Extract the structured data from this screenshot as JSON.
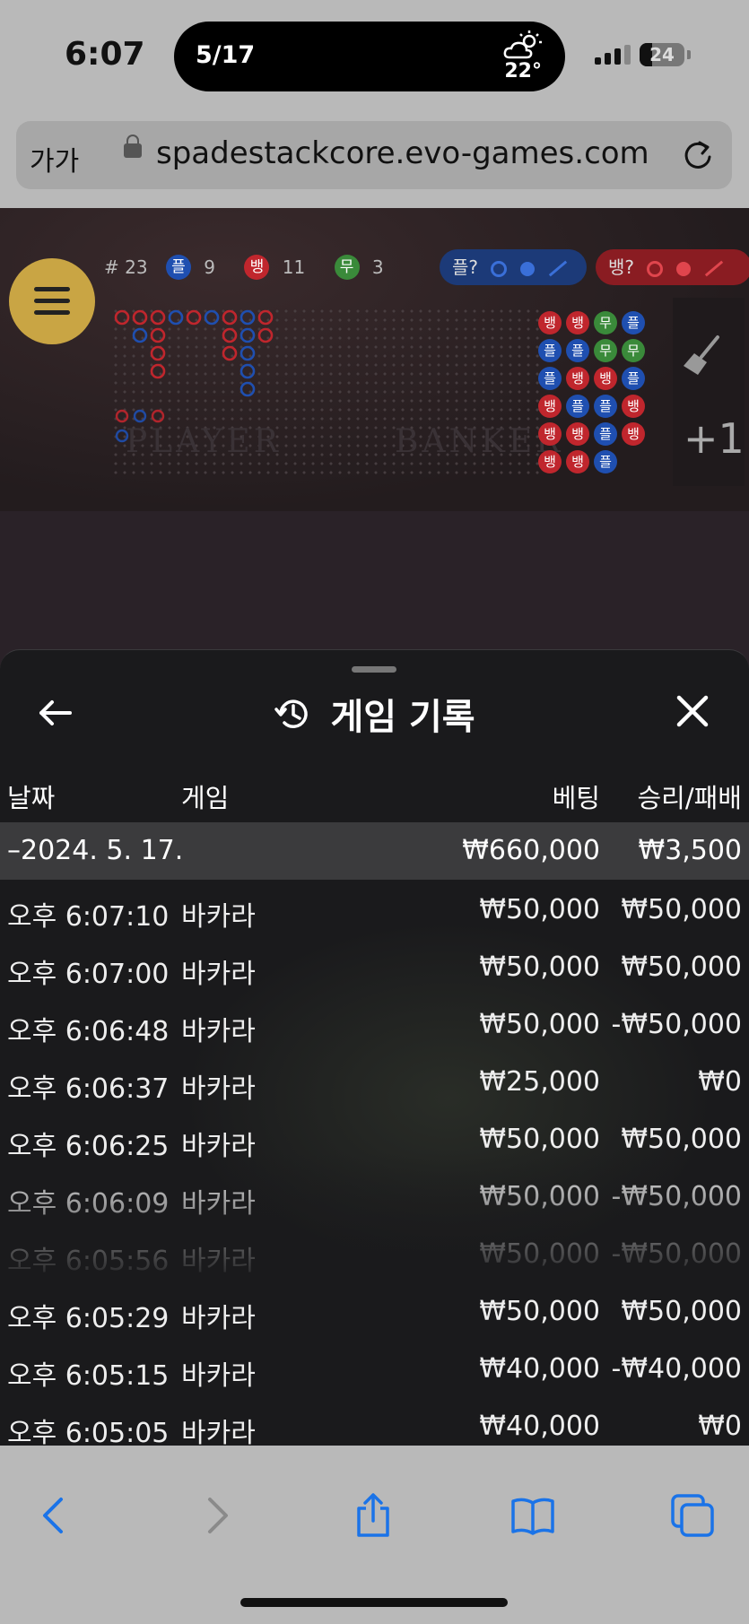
{
  "status_bar": {
    "time": "6:07",
    "island_date": "5/17",
    "island_temp": "22°",
    "weather_icon": "partly-cloudy-icon",
    "battery": "24"
  },
  "browser": {
    "reader_label": "가가",
    "url": "spadestackcore.evo-games.com"
  },
  "game": {
    "round_label": "# 23",
    "player_badge": "플",
    "player_count": "9",
    "banker_badge": "뱅",
    "banker_count": "11",
    "tie_badge": "무",
    "tie_count": "3",
    "player_predict": "플?",
    "banker_predict": "뱅?",
    "watermark_player": "PLAYER",
    "watermark_banker": "BANKER",
    "plus_label": "+1",
    "bead_plate": [
      [
        "뱅",
        "뱅",
        "무",
        "플"
      ],
      [
        "플",
        "플",
        "무",
        "무"
      ],
      [
        "플",
        "뱅",
        "뱅",
        "플"
      ],
      [
        "뱅",
        "플",
        "플",
        "뱅"
      ],
      [
        "뱅",
        "뱅",
        "플",
        "뱅"
      ],
      [
        "뱅",
        "뱅",
        "플",
        ""
      ]
    ],
    "colors": {
      "player": "#1f4fb0",
      "banker": "#c0262d",
      "tie": "#3a8a3a",
      "menu": "#c9a544"
    }
  },
  "history": {
    "title": "게임 기록",
    "columns": {
      "date": "날짜",
      "game": "게임",
      "bet": "베팅",
      "result": "승리/패배"
    },
    "date_group": {
      "date": "–2024. 5. 17.",
      "bet": "₩660,000",
      "result": "₩3,500"
    },
    "rows": [
      {
        "time": "오후 6:07:10",
        "game": "바카라",
        "bet": "₩50,000",
        "result": "₩50,000"
      },
      {
        "time": "오후 6:07:00",
        "game": "바카라",
        "bet": "₩50,000",
        "result": "₩50,000"
      },
      {
        "time": "오후 6:06:48",
        "game": "바카라",
        "bet": "₩50,000",
        "result": "-₩50,000"
      },
      {
        "time": "오후 6:06:37",
        "game": "바카라",
        "bet": "₩25,000",
        "result": "₩0"
      },
      {
        "time": "오후 6:06:25",
        "game": "바카라",
        "bet": "₩50,000",
        "result": "₩50,000"
      },
      {
        "time": "오후 6:06:09",
        "game": "바카라",
        "bet": "₩50,000",
        "result": "-₩50,000"
      },
      {
        "time": "오후 6:05:56",
        "game": "바카라",
        "bet": "₩50,000",
        "result": "-₩50,000"
      },
      {
        "time": "오후 6:05:29",
        "game": "바카라",
        "bet": "₩50,000",
        "result": "₩50,000"
      },
      {
        "time": "오후 6:05:15",
        "game": "바카라",
        "bet": "₩40,000",
        "result": "-₩40,000"
      },
      {
        "time": "오후 6:05:05",
        "game": "바카라",
        "bet": "₩40,000",
        "result": "₩0"
      }
    ]
  },
  "toolbar": {
    "back_icon": "chevron-left-icon",
    "forward_icon": "chevron-right-icon",
    "share_icon": "share-icon",
    "bookmarks_icon": "book-icon",
    "tabs_icon": "tabs-icon",
    "accent": "#1a73e8"
  }
}
